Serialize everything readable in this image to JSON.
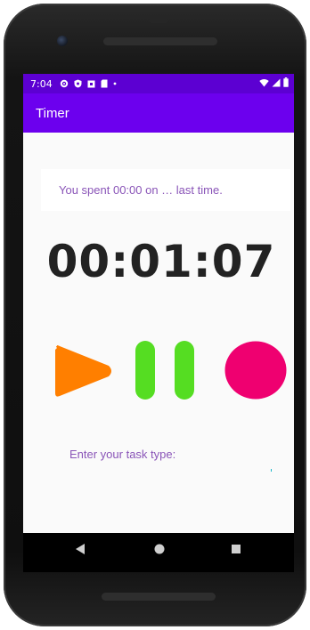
{
  "status_bar": {
    "time": "7:04",
    "icons_left": [
      "gear-icon",
      "shield-icon",
      "square-icon",
      "sim-icon",
      "dot-icon"
    ],
    "icons_right": [
      "wifi-icon",
      "signal-icon",
      "battery-icon"
    ]
  },
  "app_bar": {
    "title": "Timer"
  },
  "info": {
    "text": "You spent 00:00 on … last time."
  },
  "timer": {
    "value": "00:01:07"
  },
  "controls": {
    "play_icon": "play-icon",
    "pause_icon": "pause-icon",
    "record_icon": "record-icon",
    "colors": {
      "play": "#ff7f00",
      "pause": "#55dd22",
      "record": "#ef0070"
    }
  },
  "task": {
    "label": "Enter your task type:",
    "value": ""
  },
  "nav": {
    "icons": [
      "back-icon",
      "home-icon",
      "recents-icon"
    ]
  },
  "colors": {
    "status_bar": "#5c00d2",
    "app_bar": "#6c00ee",
    "accent_text": "#8a55b8"
  }
}
